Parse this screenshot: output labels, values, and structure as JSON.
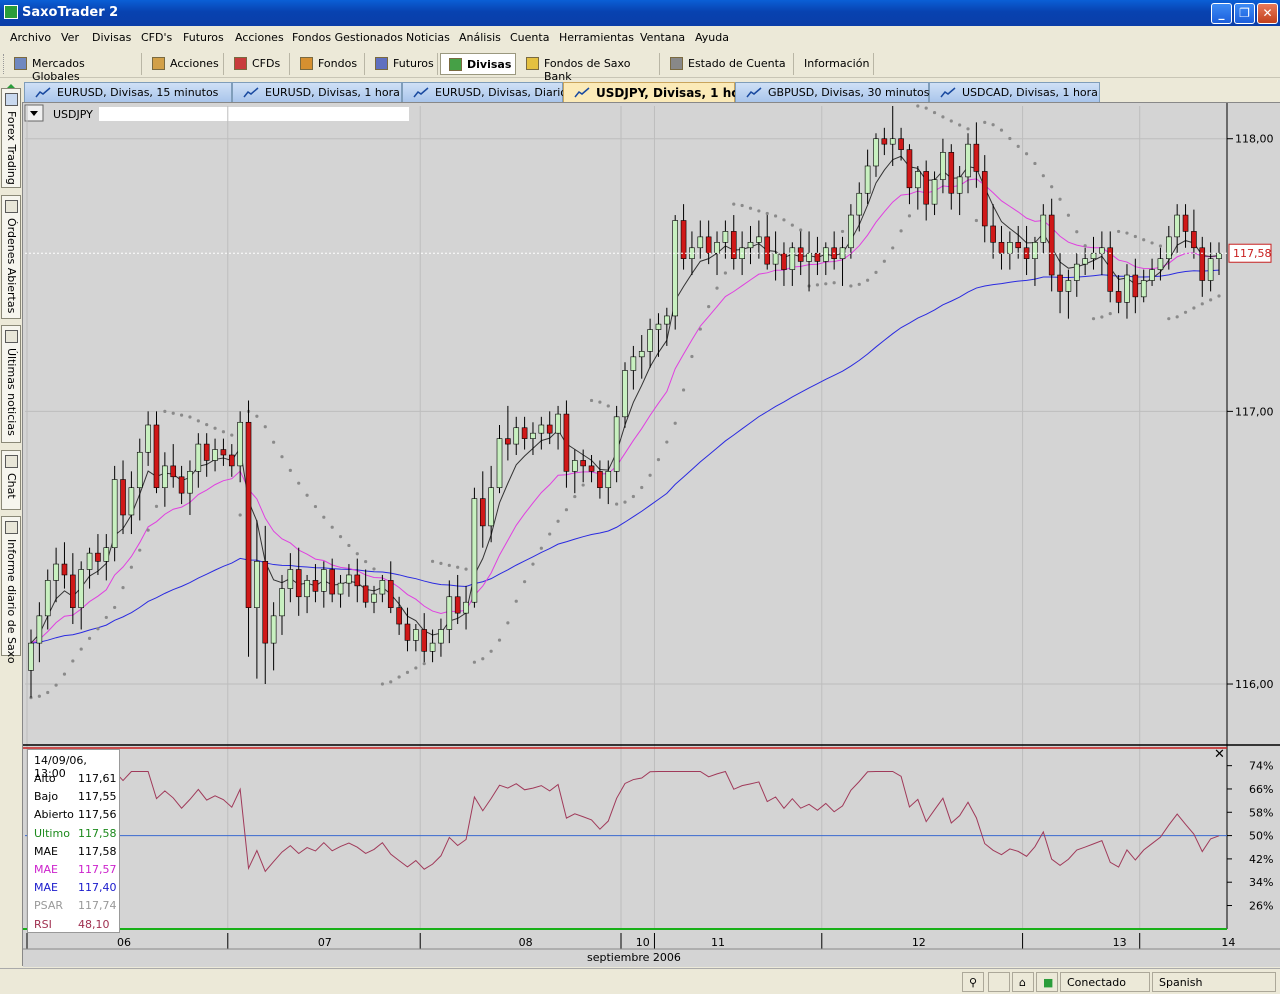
{
  "window": {
    "title": "SaxoTrader 2",
    "min": "_",
    "max": "❐",
    "close": "✕"
  },
  "menu": [
    "Archivo",
    "Ver",
    "Divisas",
    "CFD's",
    "Futuros",
    "Acciones",
    "Fondos Gestionados",
    "Noticias",
    "Análisis",
    "Cuenta",
    "Herramientas",
    "Ventana",
    "Ayuda"
  ],
  "toolbar": [
    "Mercados Globales",
    "Acciones",
    "CFDs",
    "Fondos",
    "Futuros",
    "Divisas",
    "Fondos de Saxo Bank",
    "Estado de Cuenta",
    "Información"
  ],
  "toolbar_active": "Divisas",
  "chart_tabs": [
    "EURUSD, Divisas, 15 minutos",
    "EURUSD, Divisas, 1 hora",
    "EURUSD, Divisas, Diario",
    "USDJPY, Divisas, 1 hora",
    "GBPUSD, Divisas, 30 minutos",
    "USDCAD, Divisas, 1 hora"
  ],
  "active_tab": "USDJPY, Divisas, 1 hora",
  "side_tabs": [
    "Forex Trading",
    "Órdenes Abiertas",
    "Últimas noticias",
    "Chat",
    "Informe diario de Saxo"
  ],
  "instrument": "USDJPY",
  "price_label": "117,58",
  "info": {
    "datetime": "14/09/06, 13:00",
    "rows": [
      {
        "label": "Alto",
        "value": "117,61",
        "color": "#000000"
      },
      {
        "label": "Bajo",
        "value": "117,55",
        "color": "#000000"
      },
      {
        "label": "Abierto",
        "value": "117,56",
        "color": "#000000"
      },
      {
        "label": "Ultimo",
        "value": "117,58",
        "color": "#1c8a1c"
      },
      {
        "label": "MAE",
        "value": "117,58",
        "color": "#000000"
      },
      {
        "label": "MAE",
        "value": "117,57",
        "color": "#cc22cc"
      },
      {
        "label": "MAE",
        "value": "117,40",
        "color": "#1a1acc"
      },
      {
        "label": "PSAR",
        "value": "117,74",
        "color": "#999999"
      },
      {
        "label": "RSI",
        "value": "48,10",
        "color": "#a03050"
      }
    ]
  },
  "status": {
    "connection": "Conectado",
    "language": "Spanish"
  },
  "chart_data": {
    "type": "candlestick",
    "price_axis": {
      "ticks": [
        "118,00",
        "117,00",
        "116,00"
      ],
      "values": [
        118.0,
        117.0,
        116.0
      ],
      "range": [
        115.78,
        118.12
      ]
    },
    "rsi_axis": {
      "ticks": [
        "74%",
        "66%",
        "58%",
        "50%",
        "42%",
        "34%",
        "26%"
      ],
      "values": [
        74,
        66,
        58,
        50,
        42,
        34,
        26
      ],
      "range": [
        20,
        78
      ]
    },
    "x_labels": [
      "06",
      "07",
      "08",
      "10",
      "11",
      "12",
      "13",
      "14"
    ],
    "x_label_candles": [
      11,
      35,
      59,
      73,
      82,
      106,
      130,
      143
    ],
    "x_caption": "septiembre 2006",
    "current_price": 117.58,
    "candles": [
      [
        116.05,
        116.2,
        115.95,
        116.15
      ],
      [
        116.15,
        116.3,
        116.08,
        116.25
      ],
      [
        116.25,
        116.42,
        116.2,
        116.38
      ],
      [
        116.38,
        116.5,
        116.3,
        116.44
      ],
      [
        116.44,
        116.52,
        116.35,
        116.4
      ],
      [
        116.4,
        116.48,
        116.22,
        116.28
      ],
      [
        116.28,
        116.45,
        116.2,
        116.42
      ],
      [
        116.42,
        116.5,
        116.35,
        116.48
      ],
      [
        116.48,
        116.55,
        116.4,
        116.45
      ],
      [
        116.45,
        116.55,
        116.38,
        116.5
      ],
      [
        116.5,
        116.8,
        116.45,
        116.75
      ],
      [
        116.75,
        116.82,
        116.55,
        116.62
      ],
      [
        116.62,
        116.78,
        116.55,
        116.72
      ],
      [
        116.72,
        116.9,
        116.6,
        116.85
      ],
      [
        116.85,
        117.0,
        116.8,
        116.95
      ],
      [
        116.95,
        117.0,
        116.7,
        116.72
      ],
      [
        116.72,
        116.85,
        116.65,
        116.8
      ],
      [
        116.8,
        116.88,
        116.72,
        116.76
      ],
      [
        116.76,
        116.8,
        116.66,
        116.7
      ],
      [
        116.7,
        116.82,
        116.62,
        116.78
      ],
      [
        116.78,
        116.92,
        116.72,
        116.88
      ],
      [
        116.88,
        116.92,
        116.76,
        116.82
      ],
      [
        116.82,
        116.9,
        116.78,
        116.86
      ],
      [
        116.86,
        116.9,
        116.8,
        116.84
      ],
      [
        116.84,
        116.88,
        116.76,
        116.8
      ],
      [
        116.8,
        117.0,
        116.74,
        116.96
      ],
      [
        116.96,
        117.04,
        116.1,
        116.28
      ],
      [
        116.28,
        116.6,
        116.02,
        116.45
      ],
      [
        116.45,
        116.58,
        116.0,
        116.15
      ],
      [
        116.15,
        116.3,
        116.05,
        116.25
      ],
      [
        116.25,
        116.4,
        116.18,
        116.35
      ],
      [
        116.35,
        116.48,
        116.3,
        116.42
      ],
      [
        116.42,
        116.5,
        116.25,
        116.32
      ],
      [
        116.32,
        116.4,
        116.26,
        116.38
      ],
      [
        116.38,
        116.44,
        116.3,
        116.34
      ],
      [
        116.34,
        116.45,
        116.28,
        116.42
      ],
      [
        116.42,
        116.46,
        116.3,
        116.33
      ],
      [
        116.33,
        116.4,
        116.28,
        116.37
      ],
      [
        116.37,
        116.44,
        116.32,
        116.4
      ],
      [
        116.4,
        116.46,
        116.3,
        116.36
      ],
      [
        116.36,
        116.42,
        116.28,
        116.3
      ],
      [
        116.3,
        116.36,
        116.26,
        116.33
      ],
      [
        116.33,
        116.4,
        116.3,
        116.38
      ],
      [
        116.38,
        116.45,
        116.26,
        116.28
      ],
      [
        116.28,
        116.32,
        116.18,
        116.22
      ],
      [
        116.22,
        116.28,
        116.12,
        116.16
      ],
      [
        116.16,
        116.22,
        116.12,
        116.2
      ],
      [
        116.2,
        116.26,
        116.08,
        116.12
      ],
      [
        116.12,
        116.2,
        116.08,
        116.15
      ],
      [
        116.15,
        116.24,
        116.1,
        116.2
      ],
      [
        116.2,
        116.38,
        116.15,
        116.32
      ],
      [
        116.32,
        116.4,
        116.22,
        116.26
      ],
      [
        116.26,
        116.36,
        116.2,
        116.3
      ],
      [
        116.3,
        116.72,
        116.28,
        116.68
      ],
      [
        116.68,
        116.78,
        116.5,
        116.58
      ],
      [
        116.58,
        116.8,
        116.52,
        116.72
      ],
      [
        116.72,
        116.95,
        116.7,
        116.9
      ],
      [
        116.9,
        117.02,
        116.82,
        116.88
      ],
      [
        116.88,
        116.98,
        116.84,
        116.94
      ],
      [
        116.94,
        116.98,
        116.86,
        116.9
      ],
      [
        116.9,
        116.96,
        116.84,
        116.92
      ],
      [
        116.92,
        116.98,
        116.86,
        116.95
      ],
      [
        116.95,
        117.0,
        116.88,
        116.92
      ],
      [
        116.92,
        117.02,
        116.86,
        116.99
      ],
      [
        116.99,
        117.04,
        116.72,
        116.78
      ],
      [
        116.78,
        116.86,
        116.7,
        116.82
      ],
      [
        116.82,
        116.86,
        116.74,
        116.8
      ],
      [
        116.8,
        116.84,
        116.74,
        116.78
      ],
      [
        116.78,
        116.82,
        116.68,
        116.72
      ],
      [
        116.72,
        116.82,
        116.66,
        116.78
      ],
      [
        116.78,
        117.02,
        116.74,
        116.98
      ],
      [
        116.98,
        117.18,
        116.94,
        117.15
      ],
      [
        117.15,
        117.24,
        117.08,
        117.2
      ],
      [
        117.2,
        117.28,
        117.12,
        117.22
      ],
      [
        117.22,
        117.34,
        117.16,
        117.3
      ],
      [
        117.3,
        117.36,
        117.2,
        117.32
      ],
      [
        117.32,
        117.38,
        117.24,
        117.35
      ],
      [
        117.35,
        117.72,
        117.3,
        117.7
      ],
      [
        117.7,
        117.76,
        117.52,
        117.56
      ],
      [
        117.56,
        117.66,
        117.5,
        117.6
      ],
      [
        117.6,
        117.7,
        117.56,
        117.64
      ],
      [
        117.64,
        117.7,
        117.54,
        117.58
      ],
      [
        117.58,
        117.66,
        117.5,
        117.62
      ],
      [
        117.62,
        117.7,
        117.56,
        117.66
      ],
      [
        117.66,
        117.72,
        117.52,
        117.56
      ],
      [
        117.56,
        117.66,
        117.5,
        117.6
      ],
      [
        117.6,
        117.68,
        117.54,
        117.62
      ],
      [
        117.62,
        117.7,
        117.56,
        117.64
      ],
      [
        117.64,
        117.72,
        117.52,
        117.54
      ],
      [
        117.54,
        117.66,
        117.48,
        117.58
      ],
      [
        117.58,
        117.62,
        117.46,
        117.52
      ],
      [
        117.52,
        117.62,
        117.46,
        117.6
      ],
      [
        117.6,
        117.66,
        117.5,
        117.55
      ],
      [
        117.55,
        117.66,
        117.44,
        117.58
      ],
      [
        117.58,
        117.64,
        117.5,
        117.55
      ],
      [
        117.55,
        117.62,
        117.5,
        117.6
      ],
      [
        117.6,
        117.66,
        117.52,
        117.56
      ],
      [
        117.56,
        117.64,
        117.46,
        117.6
      ],
      [
        117.6,
        117.76,
        117.56,
        117.72
      ],
      [
        117.72,
        117.84,
        117.66,
        117.8
      ],
      [
        117.8,
        117.96,
        117.76,
        117.9
      ],
      [
        117.9,
        118.02,
        117.86,
        118.0
      ],
      [
        118.0,
        118.04,
        117.94,
        117.98
      ],
      [
        117.98,
        118.12,
        117.9,
        118.0
      ],
      [
        118.0,
        118.04,
        117.92,
        117.96
      ],
      [
        117.96,
        117.98,
        117.76,
        117.82
      ],
      [
        117.82,
        117.9,
        117.74,
        117.88
      ],
      [
        117.88,
        117.92,
        117.7,
        117.76
      ],
      [
        117.76,
        117.88,
        117.72,
        117.85
      ],
      [
        117.85,
        118.0,
        117.8,
        117.95
      ],
      [
        117.95,
        117.98,
        117.74,
        117.8
      ],
      [
        117.8,
        117.9,
        117.72,
        117.86
      ],
      [
        117.86,
        118.02,
        117.8,
        117.98
      ],
      [
        117.98,
        118.06,
        117.82,
        117.88
      ],
      [
        117.88,
        117.94,
        117.62,
        117.68
      ],
      [
        117.68,
        117.76,
        117.56,
        117.62
      ],
      [
        117.62,
        117.68,
        117.52,
        117.58
      ],
      [
        117.58,
        117.66,
        117.52,
        117.62
      ],
      [
        117.62,
        117.68,
        117.56,
        117.6
      ],
      [
        117.6,
        117.68,
        117.5,
        117.56
      ],
      [
        117.56,
        117.64,
        117.46,
        117.62
      ],
      [
        117.62,
        117.76,
        117.58,
        117.72
      ],
      [
        117.72,
        117.78,
        117.44,
        117.5
      ],
      [
        117.5,
        117.58,
        117.36,
        117.44
      ],
      [
        117.44,
        117.52,
        117.34,
        117.48
      ],
      [
        117.48,
        117.58,
        117.42,
        117.54
      ],
      [
        117.54,
        117.6,
        117.5,
        117.56
      ],
      [
        117.56,
        117.64,
        117.52,
        117.58
      ],
      [
        117.58,
        117.66,
        117.5,
        117.6
      ],
      [
        117.6,
        117.66,
        117.4,
        117.44
      ],
      [
        117.44,
        117.5,
        117.36,
        117.4
      ],
      [
        117.4,
        117.54,
        117.34,
        117.5
      ],
      [
        117.5,
        117.56,
        117.36,
        117.42
      ],
      [
        117.42,
        117.52,
        117.4,
        117.48
      ],
      [
        117.48,
        117.56,
        117.46,
        117.52
      ],
      [
        117.52,
        117.6,
        117.48,
        117.56
      ],
      [
        117.56,
        117.68,
        117.52,
        117.64
      ],
      [
        117.64,
        117.76,
        117.58,
        117.72
      ],
      [
        117.72,
        117.76,
        117.6,
        117.66
      ],
      [
        117.66,
        117.74,
        117.56,
        117.6
      ],
      [
        117.6,
        117.64,
        117.42,
        117.48
      ],
      [
        117.48,
        117.62,
        117.44,
        117.56
      ],
      [
        117.56,
        117.62,
        117.5,
        117.58
      ]
    ]
  }
}
